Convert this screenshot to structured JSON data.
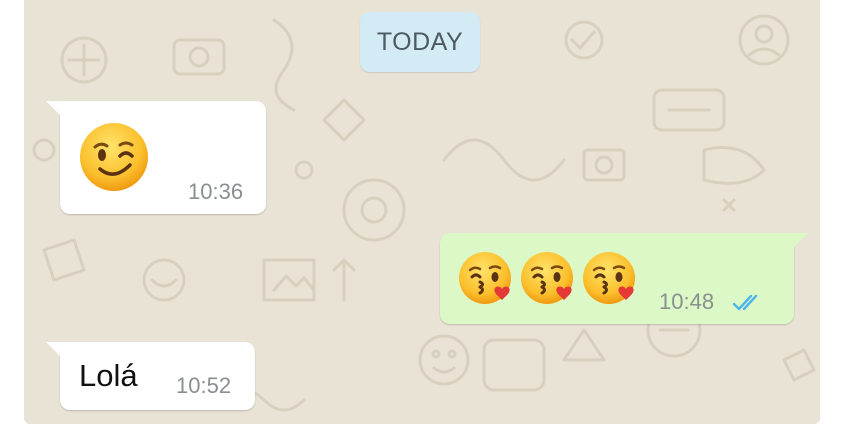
{
  "chat": {
    "date_divider": "TODAY",
    "messages": [
      {
        "direction": "incoming",
        "emoji": [
          "winking-face"
        ],
        "time": "10:36"
      },
      {
        "direction": "outgoing",
        "emoji": [
          "face-blowing-a-kiss",
          "face-blowing-a-kiss",
          "face-blowing-a-kiss"
        ],
        "time": "10:48",
        "status": "read-double-check"
      },
      {
        "direction": "incoming",
        "text": "Lolá",
        "time": "10:52"
      }
    ]
  },
  "colors": {
    "wallpaper": "#e9e3d6",
    "incoming_bubble": "#ffffff",
    "outgoing_bubble": "#dcf8c6",
    "date_chip": "#d3ebf4",
    "read_ticks": "#4fb6ec",
    "timestamp": "#8a8f90"
  }
}
